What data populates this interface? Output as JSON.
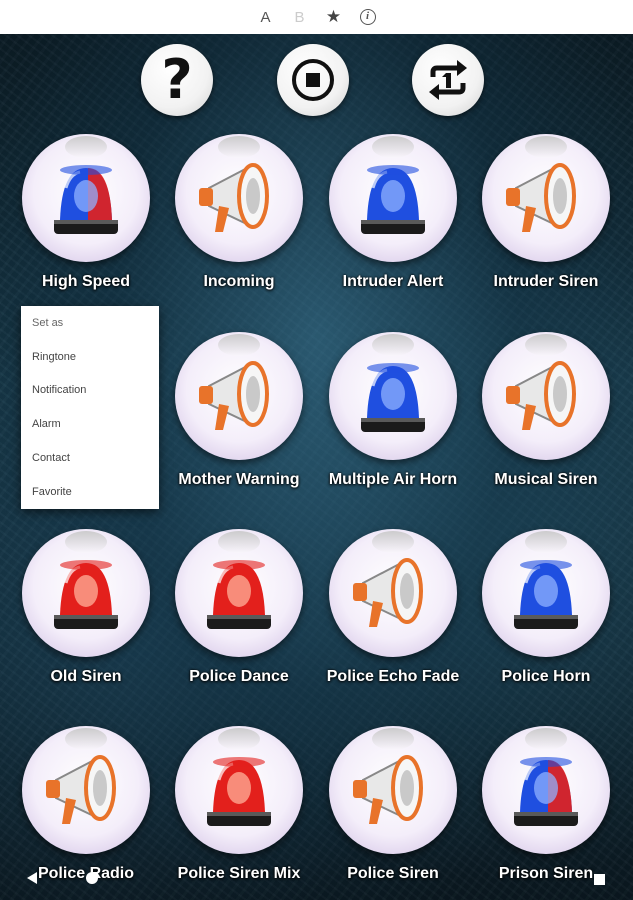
{
  "topbar": {
    "items": [
      {
        "name": "font-a",
        "label": "A"
      },
      {
        "name": "font-b",
        "label": "B"
      },
      {
        "name": "favorite",
        "label": "★"
      },
      {
        "name": "info",
        "label": "i"
      }
    ]
  },
  "controls": {
    "help_label": "?",
    "stop_icon": "stop-icon",
    "repeat_icon": "repeat-one-icon"
  },
  "sounds": [
    {
      "label": "High Speed",
      "icon": "blue-red-siren-icon"
    },
    {
      "label": "Incoming",
      "icon": "megaphone-icon"
    },
    {
      "label": "Intruder Alert",
      "icon": "blue-siren-icon"
    },
    {
      "label": "Intruder Siren",
      "icon": "megaphone-icon"
    },
    {
      "label": "Mother Warning",
      "icon": "megaphone-icon"
    },
    {
      "label": "Multiple Air Horn",
      "icon": "blue-siren-icon"
    },
    {
      "label": "Musical Siren",
      "icon": "megaphone-icon"
    },
    {
      "label": "Old Siren",
      "icon": "red-siren-icon"
    },
    {
      "label": "Police Dance",
      "icon": "red-siren-icon"
    },
    {
      "label": "Police Echo Fade",
      "icon": "megaphone-icon"
    },
    {
      "label": "Police Horn",
      "icon": "blue-siren-icon"
    },
    {
      "label": "Police Radio",
      "icon": "megaphone-icon"
    },
    {
      "label": "Police Siren Mix",
      "icon": "red-siren-icon"
    },
    {
      "label": "Police Siren",
      "icon": "megaphone-icon"
    },
    {
      "label": "Prison Siren",
      "icon": "blue-red-siren-icon"
    }
  ],
  "context_menu": {
    "items": [
      "Set as",
      "Ringtone",
      "Notification",
      "Alarm",
      "Contact",
      "Favorite"
    ]
  },
  "colors": {
    "siren_blue": "#1f4fe0",
    "siren_red": "#e3201c",
    "megaphone_white": "#e8e8e8",
    "megaphone_orange": "#e8732a"
  }
}
